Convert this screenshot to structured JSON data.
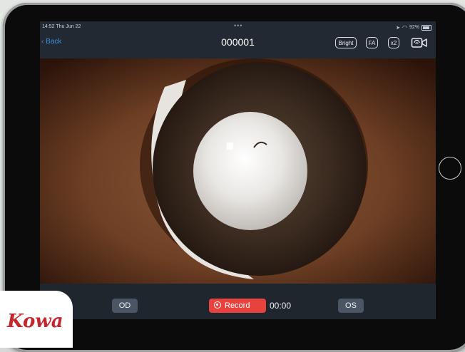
{
  "status_bar": {
    "time_date": "14:52  Thu Jun 22",
    "dots": "•••",
    "battery": "92%",
    "battery_level": 0.92
  },
  "nav": {
    "back_label": "Back",
    "title": "000001",
    "bright_label": "Bright",
    "fa_label": "FA",
    "zoom_label": "x2",
    "camera_icon": "video-camera-icon"
  },
  "bottom": {
    "od_label": "OD",
    "record_label": "Record",
    "timer": "00:00",
    "os_label": "OS"
  },
  "brand": {
    "logo_text": "Kowa"
  },
  "colors": {
    "accent": "#3b8fe0",
    "record": "#e8423f",
    "screen_bg": "#222932",
    "brand": "#c4262e"
  }
}
